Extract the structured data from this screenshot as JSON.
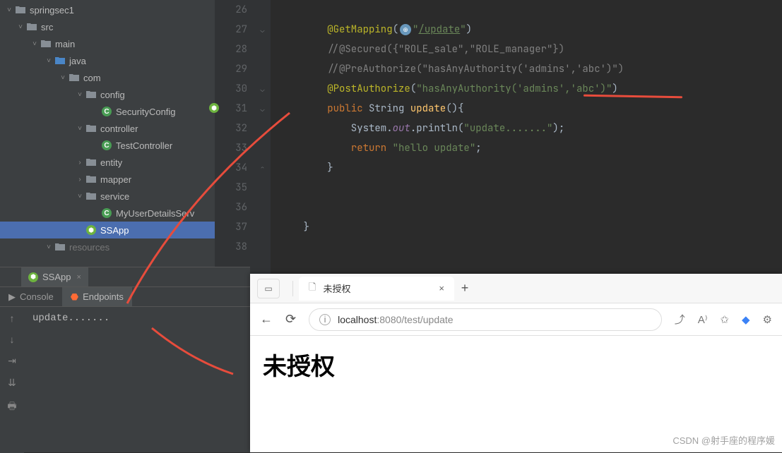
{
  "project": {
    "root": "springsec1",
    "tree": [
      {
        "depth": 0,
        "exp": "v",
        "icon": "proj",
        "label": "springsec1"
      },
      {
        "depth": 1,
        "exp": "v",
        "icon": "folder",
        "label": "src"
      },
      {
        "depth": 2,
        "exp": "v",
        "icon": "folder",
        "label": "main"
      },
      {
        "depth": 3,
        "exp": "v",
        "icon": "folder-blue",
        "label": "java"
      },
      {
        "depth": 4,
        "exp": "v",
        "icon": "folder",
        "label": "com"
      },
      {
        "depth": 5,
        "exp": "v",
        "icon": "folder",
        "label": "config"
      },
      {
        "depth": 6,
        "exp": "",
        "icon": "class",
        "label": "SecurityConfig"
      },
      {
        "depth": 5,
        "exp": "v",
        "icon": "folder",
        "label": "controller"
      },
      {
        "depth": 6,
        "exp": "",
        "icon": "class",
        "label": "TestController"
      },
      {
        "depth": 5,
        "exp": ">",
        "icon": "folder",
        "label": "entity"
      },
      {
        "depth": 5,
        "exp": ">",
        "icon": "folder",
        "label": "mapper"
      },
      {
        "depth": 5,
        "exp": "v",
        "icon": "folder",
        "label": "service"
      },
      {
        "depth": 6,
        "exp": "",
        "icon": "class",
        "label": "MyUserDetailsServ"
      },
      {
        "depth": 5,
        "exp": "",
        "icon": "spring",
        "label": "SSApp",
        "selected": true
      },
      {
        "depth": 3,
        "exp": "v",
        "icon": "folder",
        "label": "resources",
        "muted": true
      }
    ]
  },
  "editor": {
    "lines": [
      {
        "n": 26,
        "html": ""
      },
      {
        "n": 27,
        "html": "        <span class='ann'>@GetMapping</span>(<span class='icon-globe'>⊕</span><span class='str'>\"</span><span class='str-u'>/update</span><span class='str'>\"</span>)"
      },
      {
        "n": 28,
        "html": "        <span class='cmt'>//@Secured({\"ROLE_sale\",\"ROLE_manager\"})</span>"
      },
      {
        "n": 29,
        "html": "        <span class='cmt'>//@PreAuthorize(\"hasAnyAuthority('admins','abc')\")</span>"
      },
      {
        "n": 30,
        "html": "        <span class='ann'>@PostAuthorize</span>(<span class='str'>\"hasAnyAuthority('admins','abc')\"</span>)"
      },
      {
        "n": 31,
        "html": "        <span class='kw'>public</span> String <span class='fn'>update</span>(){",
        "run": true
      },
      {
        "n": 32,
        "html": "            System.<span class='static'>out</span>.println(<span class='str'>\"update.......\"</span>);"
      },
      {
        "n": 33,
        "html": "            <span class='kw'>return</span> <span class='str'>\"hello update\"</span>;"
      },
      {
        "n": 34,
        "html": "        }"
      },
      {
        "n": 35,
        "html": ""
      },
      {
        "n": 36,
        "html": ""
      },
      {
        "n": 37,
        "html": "    }"
      },
      {
        "n": 38,
        "html": ""
      }
    ]
  },
  "runpanel": {
    "tab": "SSApp",
    "subtabs": [
      "Console",
      "Endpoints"
    ],
    "output": "update......."
  },
  "browser": {
    "tab_title": "未授权",
    "url_host": "localhost",
    "url_port": ":8080",
    "url_path": "/test/update",
    "page_heading": "未授权"
  },
  "watermark": "CSDN @射手座的程序媛"
}
